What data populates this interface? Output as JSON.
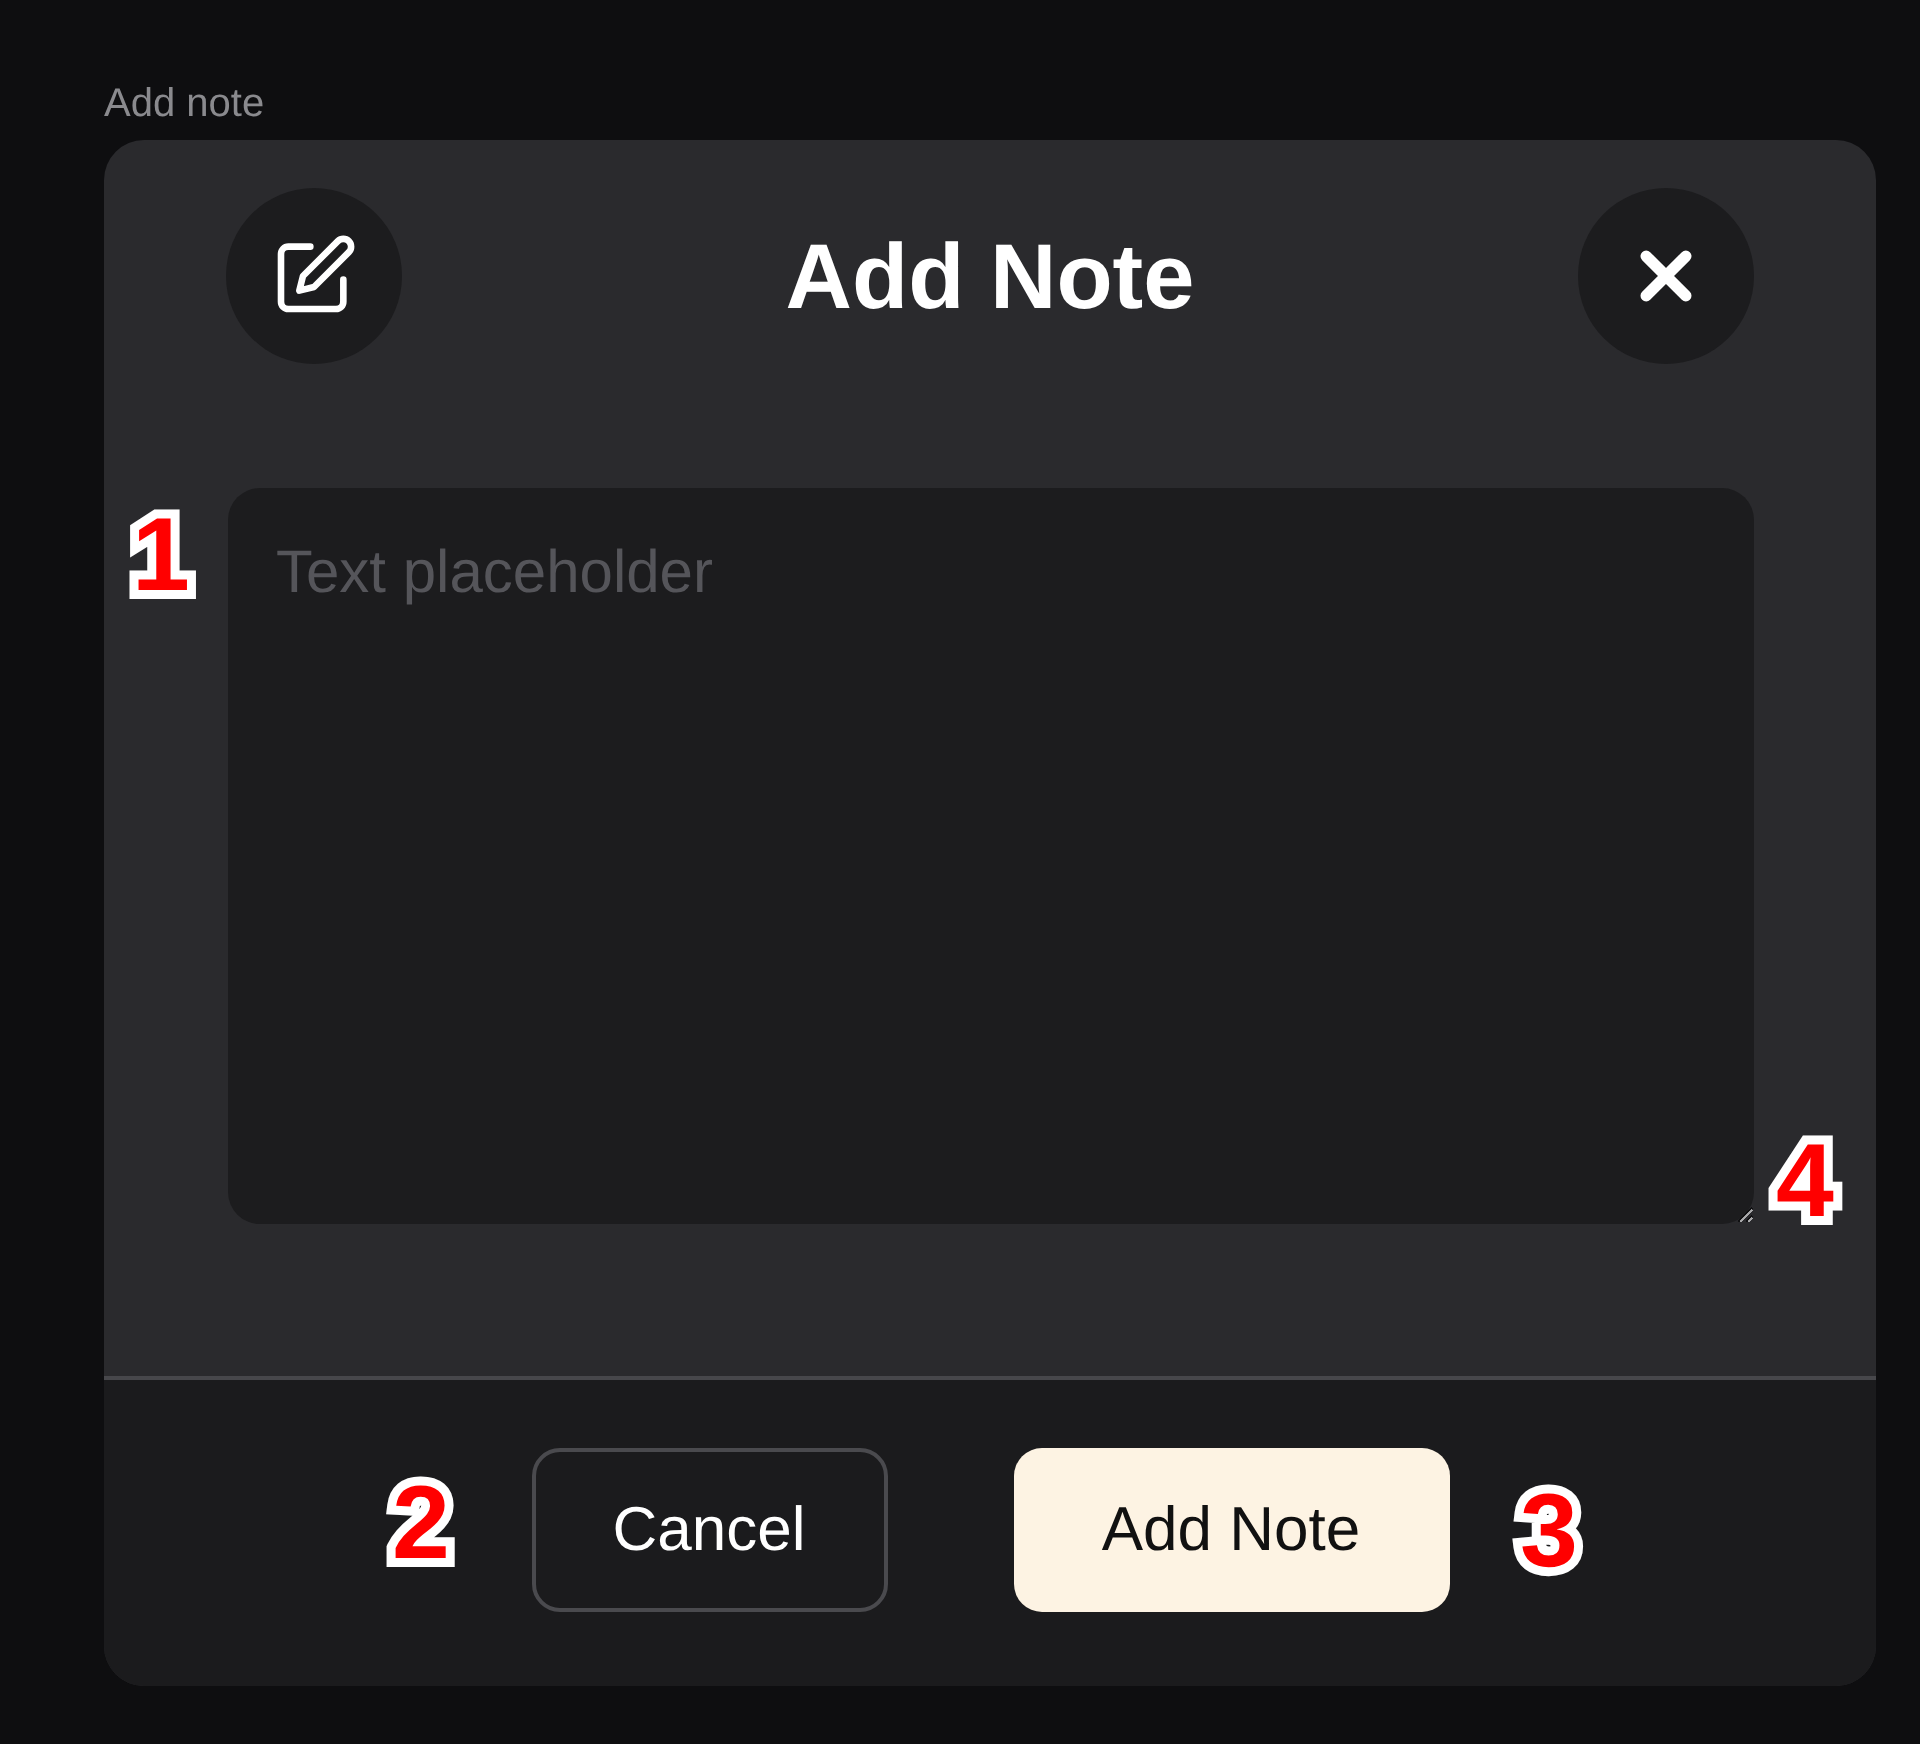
{
  "page_label": "Add note",
  "dialog": {
    "title": "Add Note",
    "note_field": {
      "placeholder": "Text placeholder"
    },
    "buttons": [
      {
        "label": "Cancel",
        "kind": "secondary"
      },
      {
        "label": "Add Note",
        "kind": "primary"
      }
    ]
  },
  "callouts": [
    "1",
    "2",
    "3",
    "4"
  ]
}
